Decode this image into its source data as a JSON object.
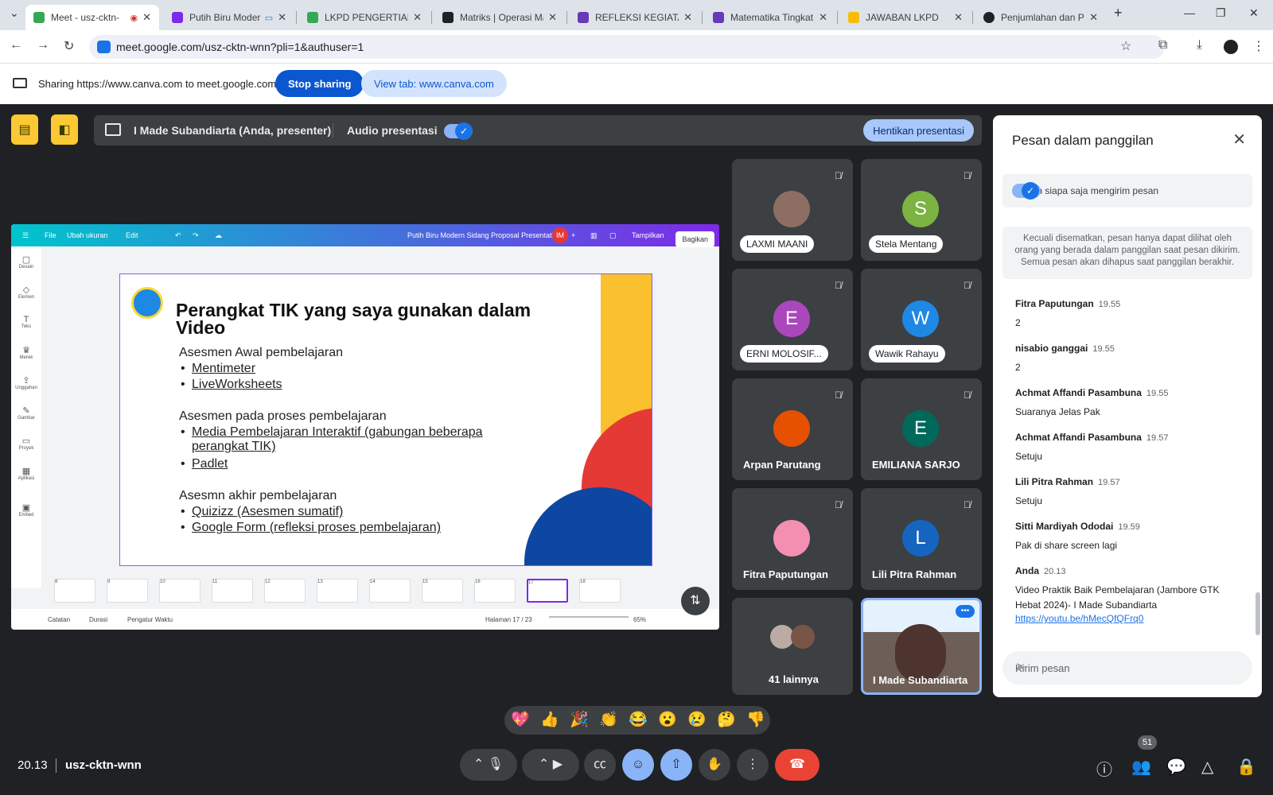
{
  "browser": {
    "tabs": [
      {
        "title": "Meet - usz-cktn-",
        "color": "#34a853"
      },
      {
        "title": "Putih Biru Moder",
        "color": "#7d2ae8"
      },
      {
        "title": "LKPD PENGERTIAN D",
        "color": "#34a853"
      },
      {
        "title": "Matriks | Operasi Ma",
        "color": "#202124"
      },
      {
        "title": "REFLEKSI KEGIATAN",
        "color": "#673ab7"
      },
      {
        "title": "Matematika Tingkat",
        "color": "#673ab7"
      },
      {
        "title": "JAWABAN LKPD",
        "color": "#fbbc04"
      },
      {
        "title": "Penjumlahan dan Pe",
        "color": "#202124"
      }
    ],
    "url": "meet.google.com/usz-cktn-wnn?pli=1&authuser=1"
  },
  "sharebar": {
    "text": "Sharing https://www.canva.com to meet.google.com",
    "stop_label": "Stop sharing",
    "view_label": "View tab: www.canva.com"
  },
  "presenter": {
    "name": "I Made Subandiarta (Anda, presenter)",
    "audio_label": "Audio presentasi",
    "stop_label": "Hentikan presentasi"
  },
  "canva": {
    "menu": {
      "file": "File",
      "resize": "Ubah ukuran",
      "edit": "Edit"
    },
    "doc_title": "Putih Biru Modern Sidang Proposal Presentation",
    "avatar": "IM",
    "present_label": "Tampilkan",
    "share_label": "Bagikan",
    "side": [
      "Desain",
      "Elemen",
      "Teks",
      "Merek",
      "Unggahan",
      "Gambar",
      "Proyek",
      "Aplikasi",
      "Embed"
    ],
    "slide": {
      "title": "Perangkat TIK yang saya gunakan dalam Video",
      "sections": [
        {
          "heading": "Asesmen Awal pembelajaran",
          "items": [
            "Mentimeter",
            "LiveWorksheets"
          ]
        },
        {
          "heading": "Asesmen pada proses pembelajaran",
          "items": [
            "Media Pembelajaran Interaktif (gabungan beberapa perangkat TIK)",
            "Padlet"
          ]
        },
        {
          "heading": "Asesmn akhir pembelajaran",
          "items": [
            "Quizizz (Asesmen sumatif)",
            "Google Form (refleksi proses pembelajaran)"
          ]
        }
      ]
    },
    "thumbs": [
      "8",
      "9",
      "10",
      "11",
      "12",
      "13",
      "14",
      "15",
      "16",
      "17",
      "18"
    ],
    "bottom": {
      "notes": "Catatan",
      "duration": "Durasi",
      "timer": "Pengatur Waktu",
      "page": "Halaman 17 / 23",
      "zoom": "65%"
    }
  },
  "participants": [
    {
      "name": "LAXMI MAANI",
      "type": "chip",
      "avatar": "photo"
    },
    {
      "name": "Stela Mentang",
      "type": "chip",
      "avatar": "S",
      "color": "#7cb342"
    },
    {
      "name": "ERNI MOLOSIF...",
      "type": "chip",
      "avatar": "E",
      "color": "#ab47bc"
    },
    {
      "name": "Wawik Rahayu",
      "type": "chip",
      "avatar": "W",
      "color": "#1e88e5"
    },
    {
      "name": "Arpan Parutang",
      "type": "plain",
      "avatar": "photo"
    },
    {
      "name": "EMILIANA SARJO",
      "type": "plain",
      "avatar": "E",
      "color": "#00695c"
    },
    {
      "name": "Fitra Paputungan",
      "type": "plain",
      "avatar": "photo"
    },
    {
      "name": "Lili Pitra Rahman",
      "type": "plain",
      "avatar": "L",
      "color": "#1565c0"
    },
    {
      "name": "41 lainnya",
      "type": "plain",
      "avatar": "group"
    },
    {
      "name": "I Made Subandiarta",
      "type": "plain",
      "avatar": "video"
    }
  ],
  "chat": {
    "title": "Pesan dalam panggilan",
    "allow_label": "Izinkan siapa saja mengirim pesan",
    "notice": "Kecuali disematkan, pesan hanya dapat dilihat oleh orang yang berada dalam panggilan saat pesan dikirim. Semua pesan akan dihapus saat panggilan berakhir.",
    "messages": [
      {
        "sender": "Fitra Paputungan",
        "time": "19.55",
        "text": "2"
      },
      {
        "sender": "nisabio ganggai",
        "time": "19.55",
        "text": "2"
      },
      {
        "sender": "Achmat Affandi Pasambuna",
        "time": "19.55",
        "text": "Suaranya Jelas Pak"
      },
      {
        "sender": "Achmat Affandi Pasambuna",
        "time": "19.57",
        "text": "Setuju"
      },
      {
        "sender": "Lili Pitra Rahman",
        "time": "19.57",
        "text": "Setuju"
      },
      {
        "sender": "Sitti Mardiyah Ododai",
        "time": "19.59",
        "text": "Pak di share screen lagi"
      },
      {
        "sender": "Anda",
        "time": "20.13",
        "text": "Video Praktik Baik Pembelajaran (Jambore GTK Hebat 2024)- I Made Subandiarta",
        "link": "https://youtu.be/hMecQfQFrq0"
      }
    ],
    "placeholder": "Kirim pesan"
  },
  "reactions": [
    "💖",
    "👍",
    "🎉",
    "👏",
    "😂",
    "😮",
    "😢",
    "🤔",
    "👎"
  ],
  "footer": {
    "time": "20.13",
    "code": "usz-cktn-wnn",
    "people_count": "51"
  }
}
